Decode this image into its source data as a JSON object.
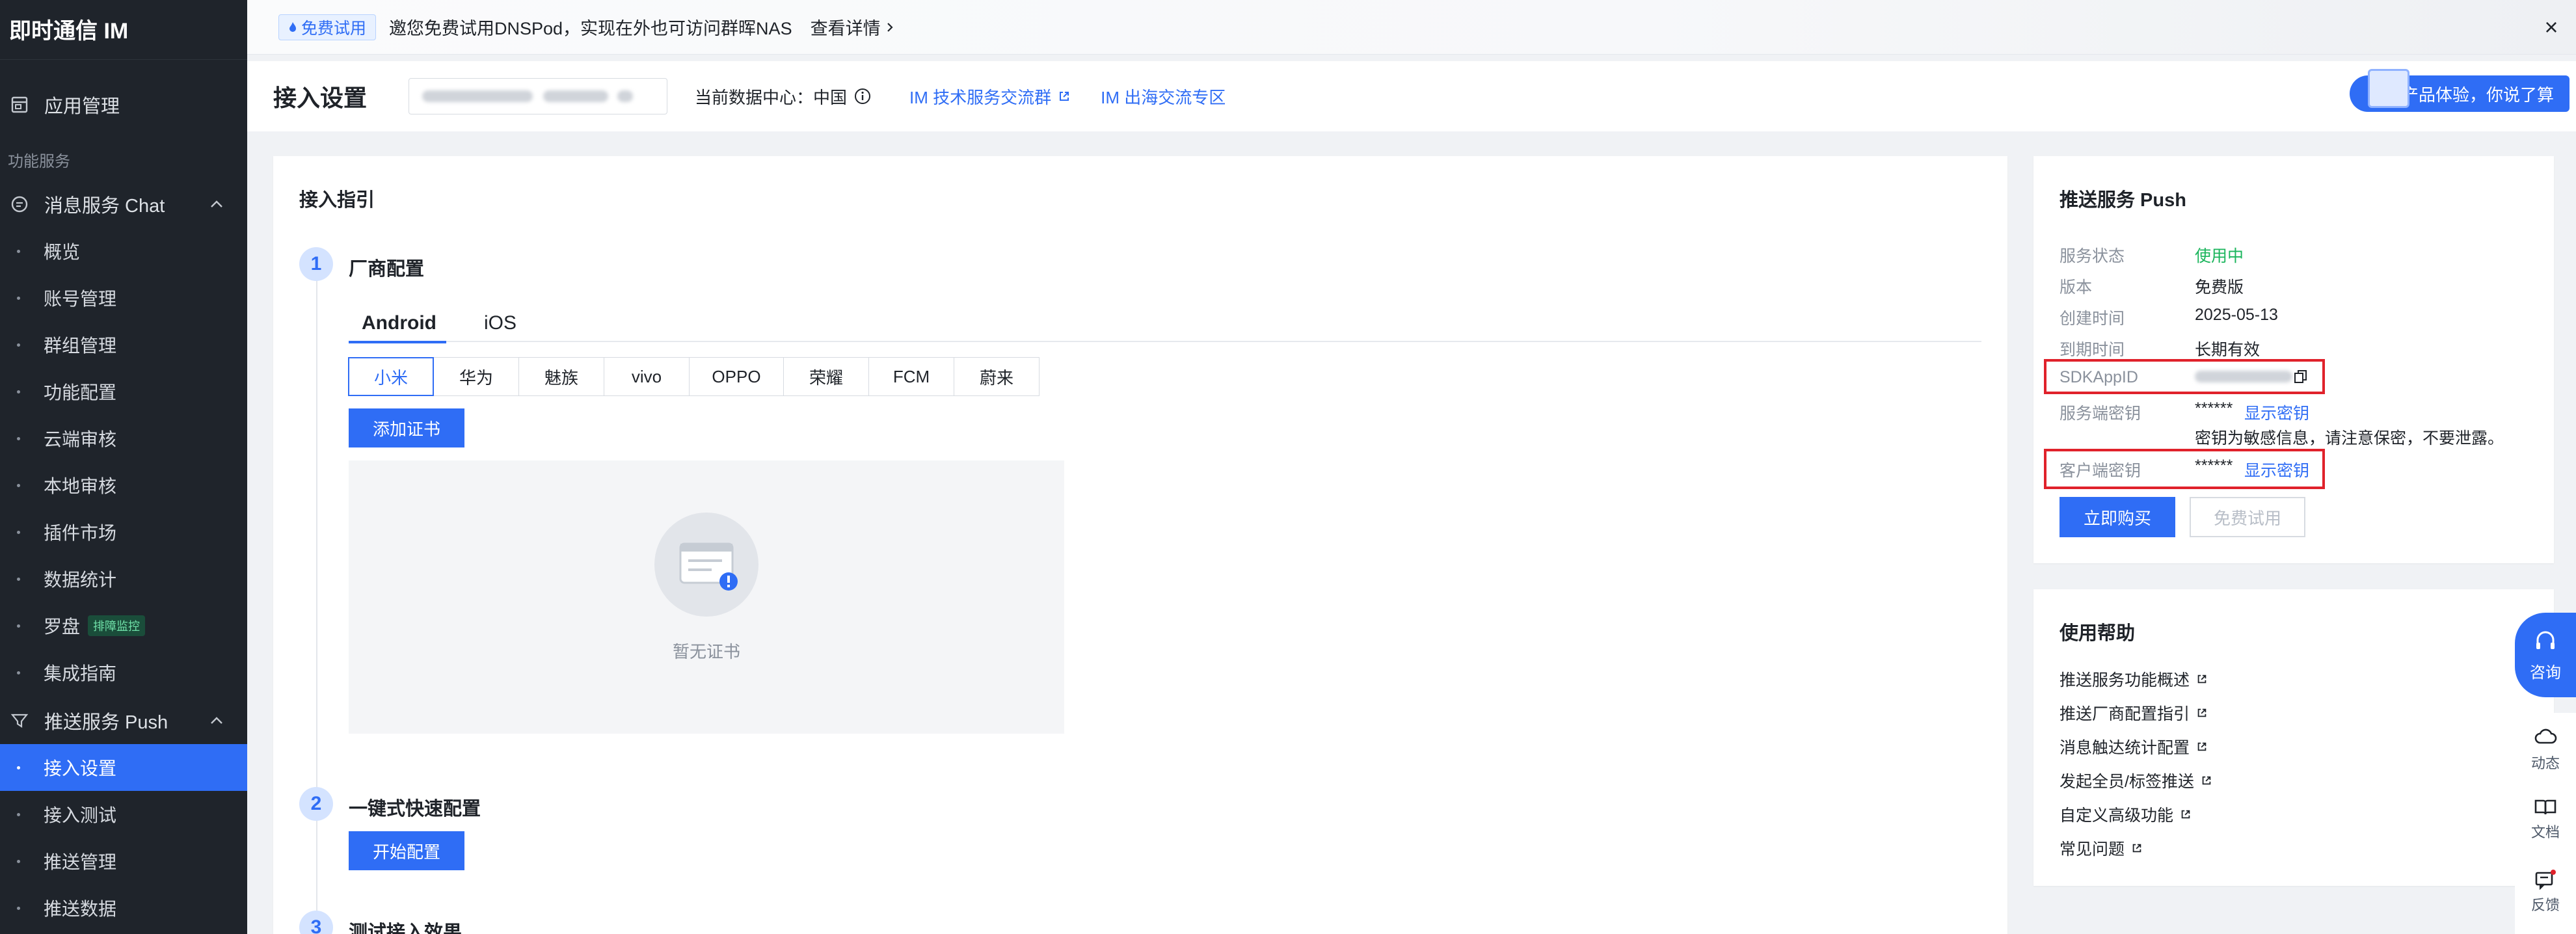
{
  "app": {
    "title": "即时通信 IM"
  },
  "sidebar": {
    "app_manage": "应用管理",
    "group_label": "功能服务",
    "chat_section": "消息服务 Chat",
    "chat_items": [
      {
        "label": "概览"
      },
      {
        "label": "账号管理"
      },
      {
        "label": "群组管理"
      },
      {
        "label": "功能配置"
      },
      {
        "label": "云端审核"
      },
      {
        "label": "本地审核"
      },
      {
        "label": "插件市场"
      },
      {
        "label": "数据统计"
      },
      {
        "label": "罗盘",
        "tag": "排障监控"
      },
      {
        "label": "集成指南"
      }
    ],
    "push_section": "推送服务 Push",
    "push_items": [
      {
        "label": "接入设置",
        "active": true
      },
      {
        "label": "接入测试"
      },
      {
        "label": "推送管理"
      },
      {
        "label": "推送数据"
      }
    ]
  },
  "banner": {
    "badge": "免费试用",
    "text": "邀您免费试用DNSPod，实现在外也可访问群晖NAS",
    "link": "查看详情"
  },
  "header": {
    "title": "接入设置",
    "data_center": "当前数据中心：中国",
    "link_group": "IM 技术服务交流群",
    "link_overseas": "IM 出海交流专区",
    "promo": "产品体验，你说了算"
  },
  "guide": {
    "title": "接入指引",
    "step1": {
      "num": "1",
      "title": "厂商配置"
    },
    "tabs": [
      "Android",
      "iOS"
    ],
    "vendors": [
      "小米",
      "华为",
      "魅族",
      "vivo",
      "OPPO",
      "荣耀",
      "FCM",
      "蔚来"
    ],
    "add_cert": "添加证书",
    "empty_text": "暂无证书",
    "step2": {
      "num": "2",
      "title": "一键式快速配置"
    },
    "start_config": "开始配置",
    "step3": {
      "num": "3",
      "title": "测试接入效果"
    }
  },
  "push_card": {
    "title": "推送服务 Push",
    "rows": {
      "status_label": "服务状态",
      "status_value": "使用中",
      "version_label": "版本",
      "version_value": "免费版",
      "created_label": "创建时间",
      "created_value": "2025-05-13",
      "expire_label": "到期时间",
      "expire_value": "长期有效",
      "sdkappid_label": "SDKAppID",
      "server_key_label": "服务端密钥",
      "server_key_mask": "******",
      "server_key_show": "显示密钥",
      "server_key_note": "密钥为敏感信息，请注意保密，不要泄露。",
      "client_key_label": "客户端密钥",
      "client_key_mask": "******",
      "client_key_show": "显示密钥"
    },
    "buy": "立即购买",
    "trial": "免费试用"
  },
  "help_card": {
    "title": "使用帮助",
    "links": [
      "推送服务功能概述",
      "推送厂商配置指引",
      "消息触达统计配置",
      "发起全员/标签推送",
      "自定义高级功能",
      "常见问题"
    ]
  },
  "rail": {
    "consult": "咨询",
    "items": [
      "动态",
      "文档",
      "反馈"
    ]
  },
  "colors": {
    "primary": "#2f6df5",
    "sidebar_bg": "#1f242b",
    "success": "#1bb55c",
    "highlight": "#e0222b"
  }
}
